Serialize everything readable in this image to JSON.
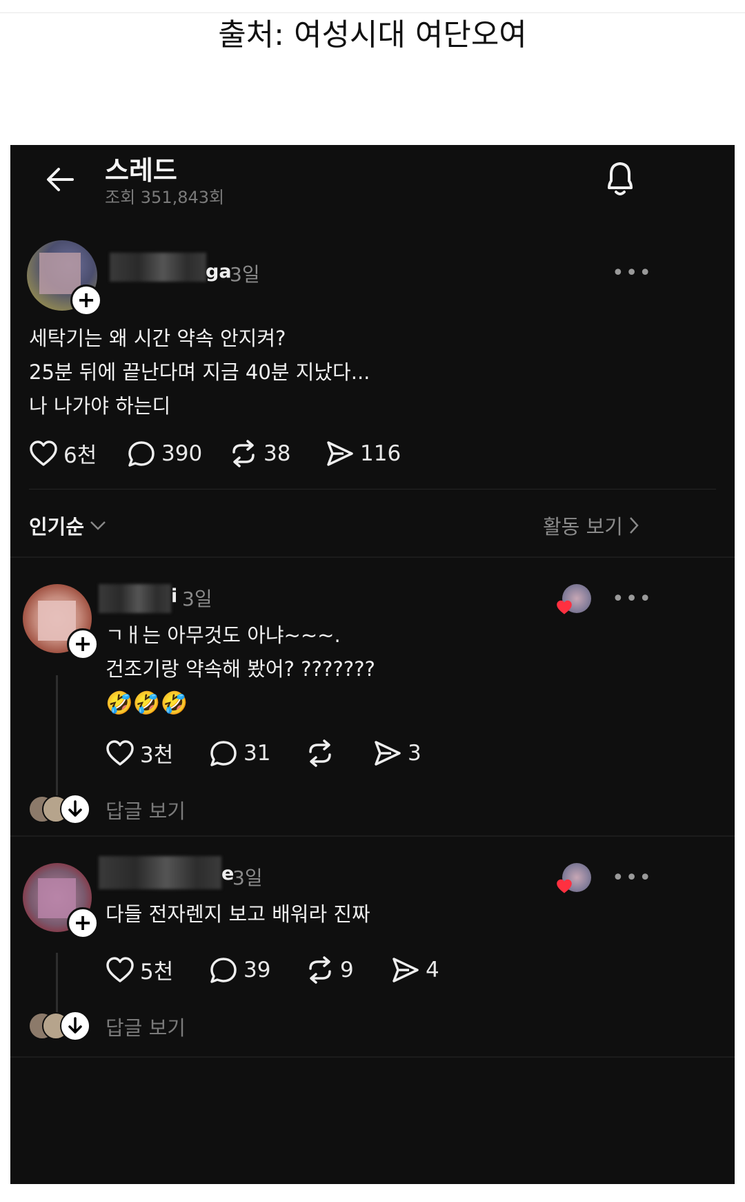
{
  "source_caption": "출처: 여성시대 여단오여",
  "header": {
    "title": "스레드",
    "views": "조회 351,843회"
  },
  "post": {
    "username_suffix": "ga",
    "time": "3일",
    "lines": [
      "세탁기는 왜 시간 약속 안지켜?",
      "25분 뒤에 끝난다며 지금 40분 지났다...",
      "나 나가야 하는디"
    ],
    "likes": "6천",
    "comments": "390",
    "reposts": "38",
    "shares": "116"
  },
  "sort": {
    "label": "인기순",
    "activity": "활동 보기"
  },
  "replies": [
    {
      "username_suffix": "i",
      "time": "3일",
      "lines": [
        "ㄱㅐ는 아무것도 아냐~~~.",
        "건조기랑 약속해 봤어? ???????",
        "🤣🤣🤣"
      ],
      "likes": "3천",
      "comments": "31",
      "reposts": "",
      "shares": "3",
      "view_replies": "답글 보기"
    },
    {
      "username_suffix": "e",
      "time": "3일",
      "lines": [
        "다들 전자렌지 보고 배워라 진짜"
      ],
      "likes": "5천",
      "comments": "39",
      "reposts": "9",
      "shares": "4",
      "view_replies": "답글 보기"
    }
  ],
  "icons": {
    "back": "arrow-left-icon",
    "bell": "bell-icon",
    "heart": "heart-icon",
    "comment": "comment-bubble-icon",
    "repost": "repost-icon",
    "share": "send-icon",
    "more": "more-dots-icon",
    "chevron": "chevron-icon"
  },
  "colors": {
    "background": "#0f0f0f",
    "text": "#f3f3f3",
    "muted": "#8a8a8a",
    "like_red": "#ff3040"
  }
}
